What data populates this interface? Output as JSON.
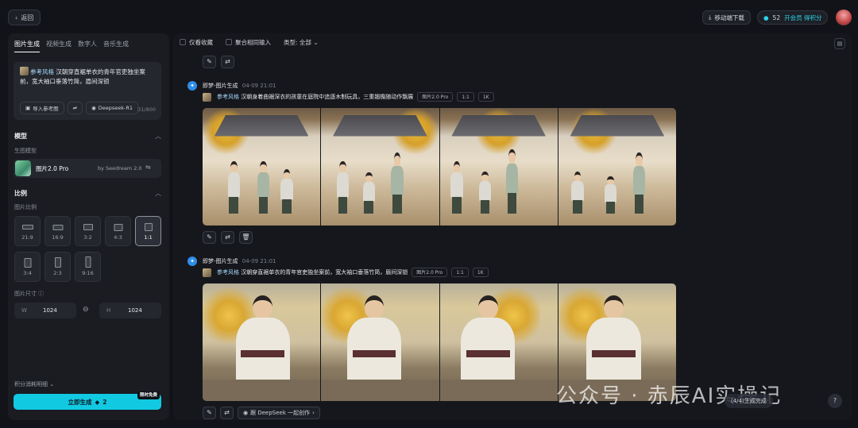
{
  "topbar": {
    "back_label": "返回",
    "download_label": "移动端下载",
    "credits_value": "52",
    "vip_label": "开会员 得积分"
  },
  "left": {
    "tabs": [
      "图片生成",
      "视频生成",
      "数字人",
      "音乐生成"
    ],
    "prompt": {
      "ref_tag": "参考风格",
      "text": "汉朝穿直裾单衣的青年官吏独坐案前，宽大袖口垂落竹简，眉间深锁",
      "import_label": "导入参考图",
      "model_chip": "Deepseek-R1",
      "counter": "31/800"
    },
    "model_section": "模型",
    "model_sub": "生图模型",
    "model_name": "图片2.0 Pro",
    "model_by": "by Seedream 2.0",
    "ratio_section": "比例",
    "ratio_sub": "图片比例",
    "ratios": [
      "21:9",
      "16:9",
      "3:2",
      "4:3",
      "1:1",
      "3:4",
      "2:3",
      "9:16"
    ],
    "size_label": "图片尺寸",
    "width_key": "W",
    "width_val": "1024",
    "height_key": "H",
    "height_val": "1024",
    "detail_link": "积分消耗明细",
    "generate_label": "立即生成",
    "generate_cost": "2",
    "limit_badge": "限时免费"
  },
  "main": {
    "filter": {
      "fav": "仅看收藏",
      "merge": "聚合相同输入",
      "type": "类型: 全部"
    },
    "generations": [
      {
        "agent": "即梦-图片生成",
        "time": "04-09  21:01",
        "ref_tag": "参考风格",
        "prompt": "汉朝身着曲裾深衣的孩童在庭院中追逐木制玩具，三重翘檐随动作飘展",
        "tags": [
          "图片2.0 Pro",
          "1:1",
          "1K"
        ]
      },
      {
        "agent": "即梦-图片生成",
        "time": "04-09  21:01",
        "ref_tag": "参考风格",
        "prompt": "汉朝穿直裾单衣的青年官吏独坐案前，宽大袖口垂落竹简，眉间深锁",
        "tags": [
          "图片2.0 Pro",
          "1:1",
          "1K"
        ]
      }
    ],
    "ds_chip": "跟 DeepSeek 一起创作",
    "watermark": "公众号 · 赤辰AI实操记",
    "status": "(4/4)生成完成"
  },
  "colors": {
    "accent": "#12c9e2",
    "bg": "#111318",
    "panel": "#1a1c22"
  }
}
